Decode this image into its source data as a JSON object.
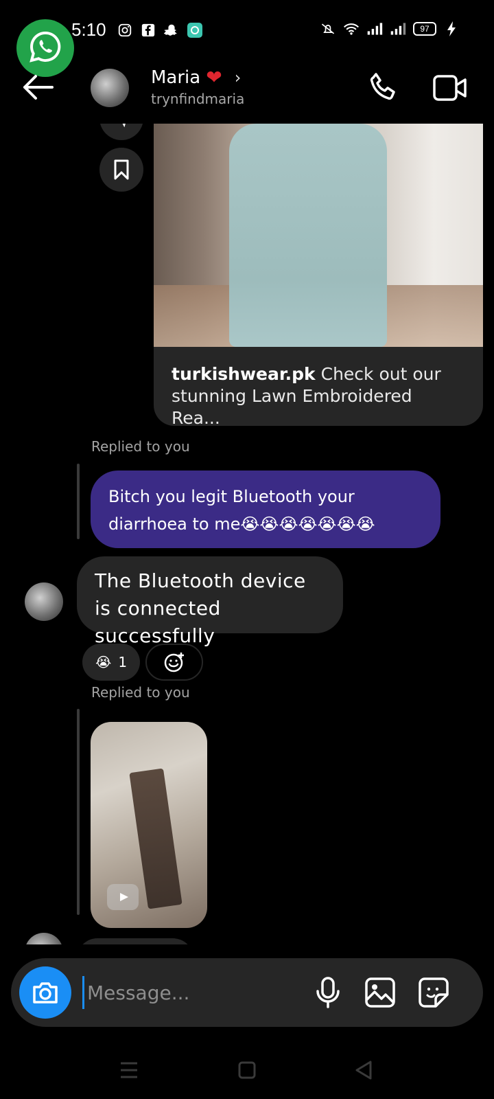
{
  "status_bar": {
    "time": "5:10",
    "battery": "97",
    "left_icons": [
      "instagram-icon",
      "facebook-icon",
      "snapchat-icon",
      "app-notification-icon"
    ],
    "right_icons": [
      "mute-icon",
      "wifi-icon",
      "signal-icon",
      "signal-icon",
      "battery-icon",
      "charging-icon"
    ]
  },
  "floating_bubble": {
    "icon": "whatsapp-icon",
    "color": "#22a34a"
  },
  "header": {
    "name": "Maria",
    "heart": "❤",
    "chevron": "›",
    "username": "trynfindmaria"
  },
  "shared_post": {
    "account": "turkishwear.pk",
    "caption": "Check out our stunning Lawn Embroidered Rea..."
  },
  "replies": [
    {
      "label": "Replied to you"
    },
    {
      "label": "Replied to you"
    }
  ],
  "quoted_message": {
    "text": "Bitch you legit Bluetooth your diarrhoea to me😭😭😭😭😭😭😭"
  },
  "message": {
    "text": "The Bluetooth device is connected successfully"
  },
  "reaction": {
    "emoji": "😭",
    "count": "1"
  },
  "composer": {
    "placeholder": "Message..."
  },
  "colors": {
    "accent": "#1a8ef5",
    "my_bubble": "#3b2b86",
    "their_bubble": "#262626"
  }
}
